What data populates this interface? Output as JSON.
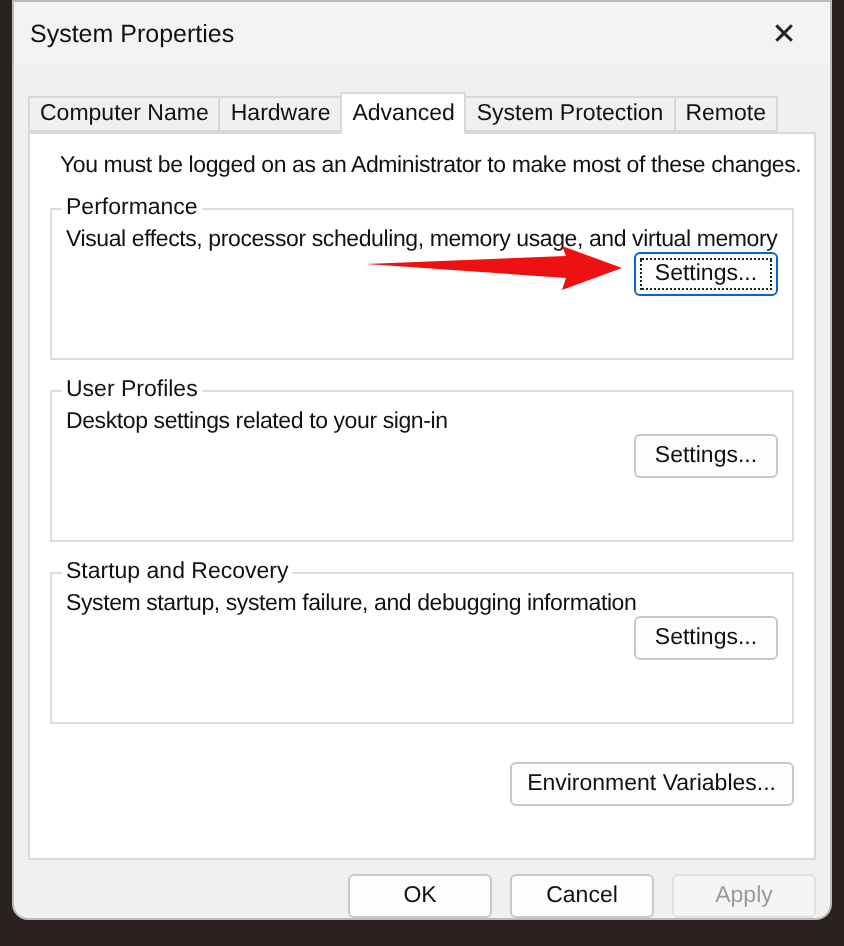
{
  "window": {
    "title": "System Properties",
    "close": "✕"
  },
  "tabs": [
    {
      "label": "Computer Name",
      "selected": false
    },
    {
      "label": "Hardware",
      "selected": false
    },
    {
      "label": "Advanced",
      "selected": true
    },
    {
      "label": "System Protection",
      "selected": false
    },
    {
      "label": "Remote",
      "selected": false
    }
  ],
  "notice": "You must be logged on as an Administrator to make most of these changes.",
  "groups": [
    {
      "title": "Performance",
      "description": "Visual effects, processor scheduling, memory usage, and virtual memory",
      "button": "Settings...",
      "focused": true,
      "annotated": true
    },
    {
      "title": "User Profiles",
      "description": "Desktop settings related to your sign-in",
      "button": "Settings...",
      "focused": false,
      "annotated": false
    },
    {
      "title": "Startup and Recovery",
      "description": "System startup, system failure, and debugging information",
      "button": "Settings...",
      "focused": false,
      "annotated": false
    }
  ],
  "environment_button": "Environment Variables...",
  "buttons": [
    {
      "label": "OK",
      "disabled": false
    },
    {
      "label": "Cancel",
      "disabled": false
    },
    {
      "label": "Apply",
      "disabled": true
    }
  ]
}
